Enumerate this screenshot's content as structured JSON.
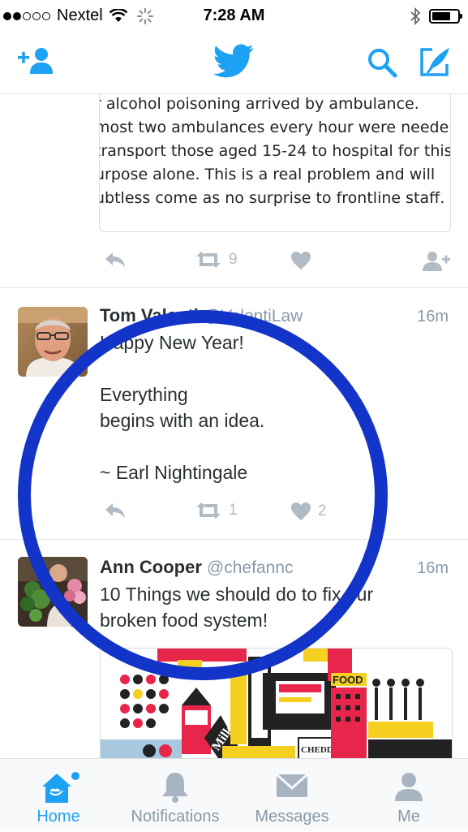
{
  "status_bar": {
    "carrier": "Nextel",
    "time": "7:28 AM"
  },
  "colors": {
    "accent": "#1da1f2",
    "annotation_circle": "#1234c8",
    "muted": "#8899a6"
  },
  "top_nav": {
    "icons": [
      "add-user-icon",
      "twitter-bird-icon",
      "search-icon",
      "compose-icon"
    ]
  },
  "quoted_card": {
    "text_lines": [
      "r alcohol poisoning arrived by ambulance.",
      "most two ambulances every hour were neede",
      "transport those aged 15-24 to hospital for this",
      "urpose alone. This is a real problem and will",
      "ubtless come as no surprise to frontline staff."
    ]
  },
  "tweets": [
    {
      "retweets": "9",
      "likes": ""
    },
    {
      "name": "Tom Valenti",
      "handle": "@ValentiLaw",
      "time": "16m",
      "text": "Happy New Year!\n\nEverything\nbegins with an idea.\n\n~ Earl Nightingale",
      "retweets": "1",
      "likes": "2"
    },
    {
      "name": "Ann Cooper",
      "handle": "@chefannc",
      "time": "16m",
      "text": "10 Things we should do to fix our\nbroken food system!",
      "media_labels": {
        "food": "FOOD",
        "milk": "Milk",
        "cheddar": "CHEDDAR"
      }
    }
  ],
  "tab_bar": {
    "tabs": [
      {
        "label": "Home"
      },
      {
        "label": "Notifications"
      },
      {
        "label": "Messages"
      },
      {
        "label": "Me"
      }
    ]
  }
}
